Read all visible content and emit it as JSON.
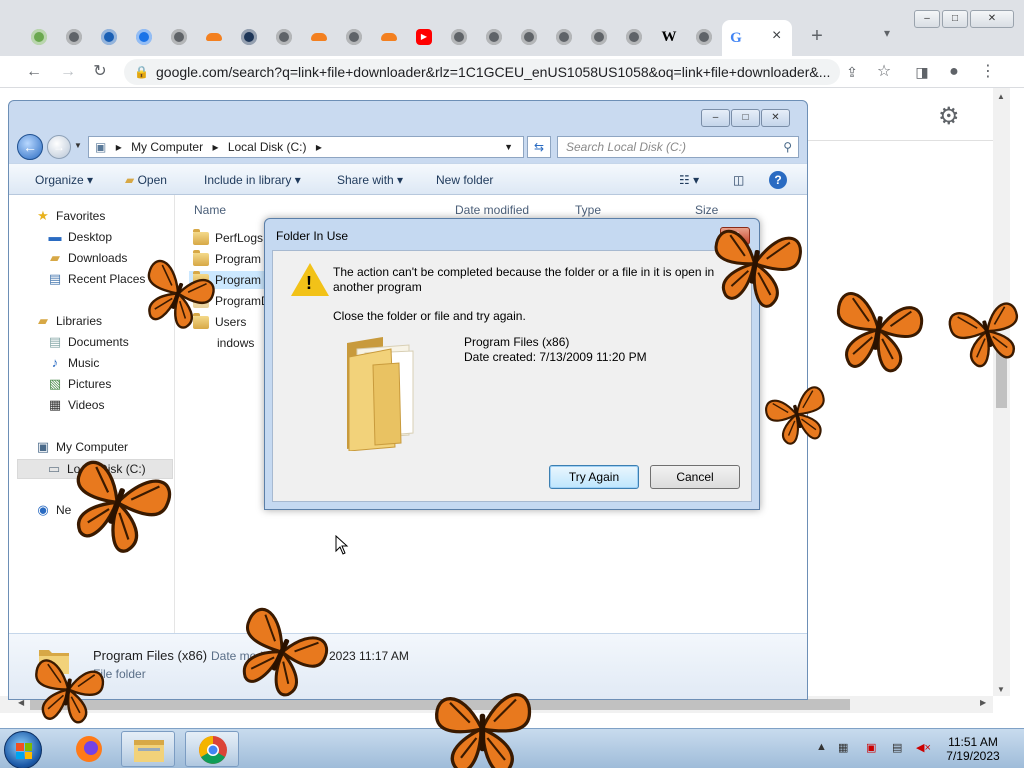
{
  "browser": {
    "url": "google.com/search?q=link+file+downloader&rlz=1C1GCEU_enUS1058US1058&oq=link+file+downloader&...",
    "tabs": [
      {
        "icon": "frog-icon",
        "color": "#6aa84f"
      },
      {
        "icon": "globe-icon",
        "color": "#5f6368"
      },
      {
        "icon": "chart-icon",
        "color": "#1a5fb4"
      },
      {
        "icon": "gear-icon",
        "color": "#1a73e8"
      },
      {
        "icon": "globe-icon",
        "color": "#5f6368"
      },
      {
        "icon": "cloud-icon",
        "color": "#f38020"
      },
      {
        "icon": "target-icon",
        "color": "#1d3557"
      },
      {
        "icon": "globe-icon",
        "color": "#5f6368"
      },
      {
        "icon": "cloud-icon",
        "color": "#f38020"
      },
      {
        "icon": "globe-icon",
        "color": "#5f6368"
      },
      {
        "icon": "cloud-icon",
        "color": "#f38020"
      },
      {
        "icon": "youtube-icon",
        "color": "#ff0000"
      },
      {
        "icon": "chrome-icon",
        "color": "#5f6368"
      },
      {
        "icon": "chrome-icon",
        "color": "#5f6368"
      },
      {
        "icon": "chrome-icon",
        "color": "#5f6368"
      },
      {
        "icon": "chrome-icon",
        "color": "#5f6368"
      },
      {
        "icon": "chrome-icon",
        "color": "#5f6368"
      },
      {
        "icon": "chrome-icon",
        "color": "#5f6368"
      },
      {
        "icon": "wikipedia-icon",
        "color": "#000000"
      },
      {
        "icon": "globe-icon",
        "color": "#5f6368"
      },
      {
        "icon": "google-icon",
        "color": "#4285f4"
      }
    ],
    "wiki_glyph": "W",
    "google_glyph": "G",
    "new_tab": "+",
    "close_tab": "×"
  },
  "explorer": {
    "breadcrumb": [
      "My Computer",
      "Local Disk (C:)"
    ],
    "search_placeholder": "Search Local Disk (C:)",
    "commands": {
      "organize": "Organize",
      "open": "Open",
      "include_in_library": "Include in library",
      "share_with": "Share with",
      "new_folder": "New folder"
    },
    "nav": {
      "favorites": "Favorites",
      "desktop": "Desktop",
      "downloads": "Downloads",
      "recent_places": "Recent Places",
      "libraries": "Libraries",
      "documents": "Documents",
      "music": "Music",
      "pictures": "Pictures",
      "videos": "Videos",
      "my_computer": "My Computer",
      "local_disk": "Local Disk (C:)",
      "network": "Ne"
    },
    "columns": {
      "name": "Name",
      "date_modified": "Date modified",
      "type": "Type",
      "size": "Size"
    },
    "files": [
      "PerfLogs",
      "Program",
      "Program",
      "ProgramD",
      "Users",
      "indows"
    ],
    "details": {
      "name": "Program Files (x86)",
      "date_label": "Date modified:",
      "date_value": "2023 11:17 AM",
      "type": "File folder"
    }
  },
  "dialog": {
    "title": "Folder In Use",
    "message": "The action can't be completed because the folder or a file in it is open in another program",
    "instruction": "Close the folder or file and try again.",
    "file_name": "Program Files (x86)",
    "date_created": "Date created: 7/13/2009 11:20 PM",
    "try_again": "Try Again",
    "cancel": "Cancel"
  },
  "taskbar": {
    "time": "11:51 AM",
    "date": "7/19/2023"
  },
  "colors": {
    "accent": "#2a6bc2",
    "warning": "#f2c218",
    "butterfly": "#e8791e"
  }
}
